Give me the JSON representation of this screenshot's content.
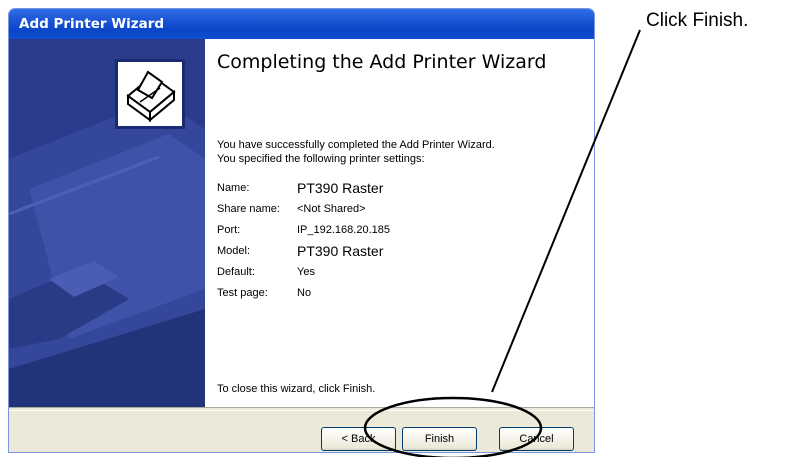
{
  "window": {
    "title": "Add Printer Wizard"
  },
  "heading": "Completing the Add Printer Wizard",
  "intro_lines": [
    "You have successfully completed the Add Printer Wizard.",
    "You specified the following printer settings:"
  ],
  "settings": [
    {
      "label": "Name:",
      "value": "PT390 Raster"
    },
    {
      "label": "Share name:",
      "value": "<Not Shared>"
    },
    {
      "label": "Port:",
      "value": "IP_192.168.20.185"
    },
    {
      "label": "Model:",
      "value": "PT390 Raster"
    },
    {
      "label": "Default:",
      "value": "Yes"
    },
    {
      "label": "Test page:",
      "value": "No"
    }
  ],
  "closing": "To close this wizard, click Finish.",
  "buttons": {
    "back": "< Back",
    "finish": "Finish",
    "cancel": "Cancel"
  },
  "annotation": {
    "callout": "Click Finish."
  },
  "icons": {
    "printer": "printer-icon",
    "side_art": "printer-illustration"
  },
  "colors": {
    "title_bar": "#0a46c8",
    "side_panel": "#2b3c8d",
    "dialog_bg": "#ece9d8",
    "annotation": "#000000"
  }
}
